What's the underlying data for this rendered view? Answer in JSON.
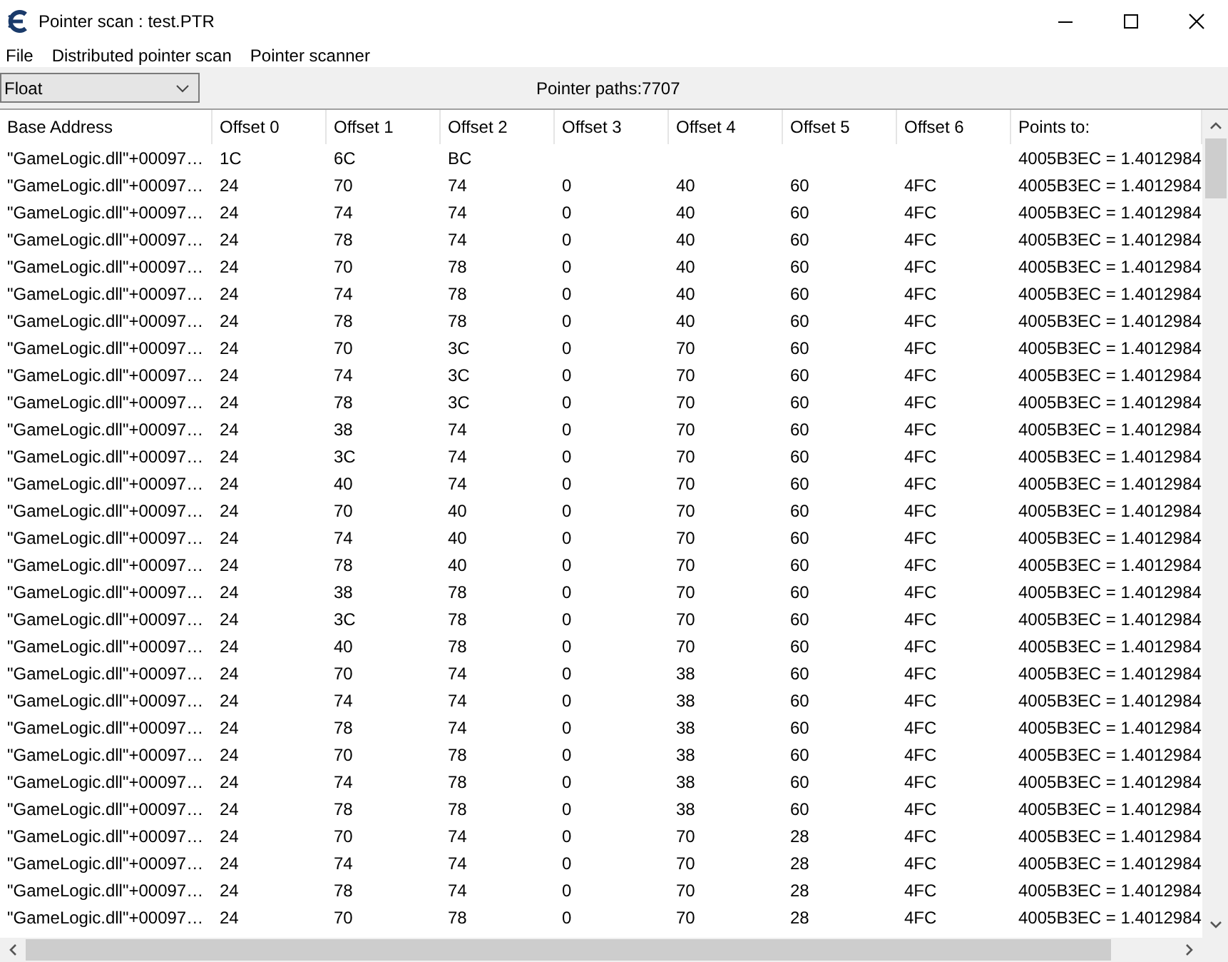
{
  "window": {
    "title": "Pointer scan : test.PTR"
  },
  "menu": [
    "File",
    "Distributed pointer scan",
    "Pointer scanner"
  ],
  "type_select": {
    "value": "Float"
  },
  "pointer_paths": "Pointer paths:7707",
  "table": {
    "columns": [
      "Base Address",
      "Offset 0",
      "Offset 1",
      "Offset 2",
      "Offset 3",
      "Offset 4",
      "Offset 5",
      "Offset 6",
      "Points to:"
    ],
    "rows": [
      [
        "\"GameLogic.dll\"+00097…",
        "1C",
        "6C",
        "BC",
        null,
        null,
        null,
        null,
        "4005B3EC = 1.4012984"
      ],
      [
        "\"GameLogic.dll\"+00097…",
        "24",
        "70",
        "74",
        "0",
        "40",
        "60",
        "4FC",
        "4005B3EC = 1.4012984"
      ],
      [
        "\"GameLogic.dll\"+00097…",
        "24",
        "74",
        "74",
        "0",
        "40",
        "60",
        "4FC",
        "4005B3EC = 1.4012984"
      ],
      [
        "\"GameLogic.dll\"+00097…",
        "24",
        "78",
        "74",
        "0",
        "40",
        "60",
        "4FC",
        "4005B3EC = 1.4012984"
      ],
      [
        "\"GameLogic.dll\"+00097…",
        "24",
        "70",
        "78",
        "0",
        "40",
        "60",
        "4FC",
        "4005B3EC = 1.4012984"
      ],
      [
        "\"GameLogic.dll\"+00097…",
        "24",
        "74",
        "78",
        "0",
        "40",
        "60",
        "4FC",
        "4005B3EC = 1.4012984"
      ],
      [
        "\"GameLogic.dll\"+00097…",
        "24",
        "78",
        "78",
        "0",
        "40",
        "60",
        "4FC",
        "4005B3EC = 1.4012984"
      ],
      [
        "\"GameLogic.dll\"+00097…",
        "24",
        "70",
        "3C",
        "0",
        "70",
        "60",
        "4FC",
        "4005B3EC = 1.4012984"
      ],
      [
        "\"GameLogic.dll\"+00097…",
        "24",
        "74",
        "3C",
        "0",
        "70",
        "60",
        "4FC",
        "4005B3EC = 1.4012984"
      ],
      [
        "\"GameLogic.dll\"+00097…",
        "24",
        "78",
        "3C",
        "0",
        "70",
        "60",
        "4FC",
        "4005B3EC = 1.4012984"
      ],
      [
        "\"GameLogic.dll\"+00097…",
        "24",
        "38",
        "74",
        "0",
        "70",
        "60",
        "4FC",
        "4005B3EC = 1.4012984"
      ],
      [
        "\"GameLogic.dll\"+00097…",
        "24",
        "3C",
        "74",
        "0",
        "70",
        "60",
        "4FC",
        "4005B3EC = 1.4012984"
      ],
      [
        "\"GameLogic.dll\"+00097…",
        "24",
        "40",
        "74",
        "0",
        "70",
        "60",
        "4FC",
        "4005B3EC = 1.4012984"
      ],
      [
        "\"GameLogic.dll\"+00097…",
        "24",
        "70",
        "40",
        "0",
        "70",
        "60",
        "4FC",
        "4005B3EC = 1.4012984"
      ],
      [
        "\"GameLogic.dll\"+00097…",
        "24",
        "74",
        "40",
        "0",
        "70",
        "60",
        "4FC",
        "4005B3EC = 1.4012984"
      ],
      [
        "\"GameLogic.dll\"+00097…",
        "24",
        "78",
        "40",
        "0",
        "70",
        "60",
        "4FC",
        "4005B3EC = 1.4012984"
      ],
      [
        "\"GameLogic.dll\"+00097…",
        "24",
        "38",
        "78",
        "0",
        "70",
        "60",
        "4FC",
        "4005B3EC = 1.4012984"
      ],
      [
        "\"GameLogic.dll\"+00097…",
        "24",
        "3C",
        "78",
        "0",
        "70",
        "60",
        "4FC",
        "4005B3EC = 1.4012984"
      ],
      [
        "\"GameLogic.dll\"+00097…",
        "24",
        "40",
        "78",
        "0",
        "70",
        "60",
        "4FC",
        "4005B3EC = 1.4012984"
      ],
      [
        "\"GameLogic.dll\"+00097…",
        "24",
        "70",
        "74",
        "0",
        "38",
        "60",
        "4FC",
        "4005B3EC = 1.4012984"
      ],
      [
        "\"GameLogic.dll\"+00097…",
        "24",
        "74",
        "74",
        "0",
        "38",
        "60",
        "4FC",
        "4005B3EC = 1.4012984"
      ],
      [
        "\"GameLogic.dll\"+00097…",
        "24",
        "78",
        "74",
        "0",
        "38",
        "60",
        "4FC",
        "4005B3EC = 1.4012984"
      ],
      [
        "\"GameLogic.dll\"+00097…",
        "24",
        "70",
        "78",
        "0",
        "38",
        "60",
        "4FC",
        "4005B3EC = 1.4012984"
      ],
      [
        "\"GameLogic.dll\"+00097…",
        "24",
        "74",
        "78",
        "0",
        "38",
        "60",
        "4FC",
        "4005B3EC = 1.4012984"
      ],
      [
        "\"GameLogic.dll\"+00097…",
        "24",
        "78",
        "78",
        "0",
        "38",
        "60",
        "4FC",
        "4005B3EC = 1.4012984"
      ],
      [
        "\"GameLogic.dll\"+00097…",
        "24",
        "70",
        "74",
        "0",
        "70",
        "28",
        "4FC",
        "4005B3EC = 1.4012984"
      ],
      [
        "\"GameLogic.dll\"+00097…",
        "24",
        "74",
        "74",
        "0",
        "70",
        "28",
        "4FC",
        "4005B3EC = 1.4012984"
      ],
      [
        "\"GameLogic.dll\"+00097…",
        "24",
        "78",
        "74",
        "0",
        "70",
        "28",
        "4FC",
        "4005B3EC = 1.4012984"
      ],
      [
        "\"GameLogic.dll\"+00097…",
        "24",
        "70",
        "78",
        "0",
        "70",
        "28",
        "4FC",
        "4005B3EC = 1.4012984"
      ]
    ]
  }
}
